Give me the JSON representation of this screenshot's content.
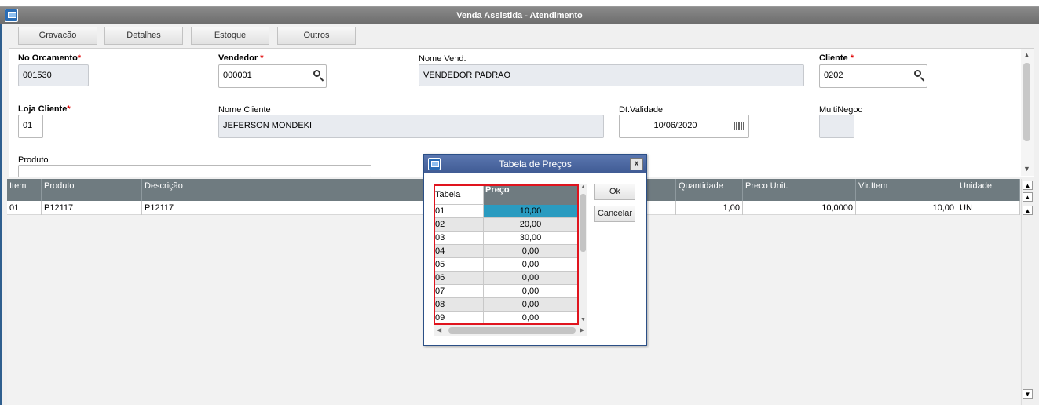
{
  "window": {
    "title": "Venda Assistida - Atendimento"
  },
  "toolbar": {
    "gravacao": "Gravacão",
    "detalhes": "Detalhes",
    "estoque": "Estoque",
    "outros": "Outros"
  },
  "form": {
    "required_mark": "*",
    "no_orcamento": {
      "label": "No Orcamento",
      "value": "001530"
    },
    "vendedor": {
      "label": "Vendedor",
      "value": "000001"
    },
    "nome_vend": {
      "label": "Nome Vend.",
      "value": "VENDEDOR PADRAO"
    },
    "cliente": {
      "label": "Cliente",
      "value": "0202"
    },
    "loja_cliente": {
      "label": "Loja Cliente",
      "value": "01"
    },
    "nome_cliente": {
      "label": "Nome Cliente",
      "value": "JEFERSON MONDEKI"
    },
    "dt_validade": {
      "label": "Dt.Validade",
      "value": "10/06/2020"
    },
    "multinegoc": {
      "label": "MultiNegoc",
      "value": ""
    },
    "produto": {
      "label": "Produto",
      "value": ""
    }
  },
  "grid": {
    "columns": [
      "Item",
      "Produto",
      "Descrição",
      "Quantidade",
      "Preco Unit.",
      "Vlr.Item",
      "Unidade"
    ],
    "rows": [
      {
        "item": "01",
        "produto": "P12117",
        "descricao": "P12117",
        "quantidade": "1,00",
        "preco_unit": "10,0000",
        "vlr_item": "10,00",
        "unidade": "UN"
      }
    ]
  },
  "dialog": {
    "title": "Tabela de Preços",
    "close": "x",
    "col_tabela": "Tabela",
    "col_preco": "Preço",
    "rows": [
      {
        "tabela": "01",
        "preco": "10,00"
      },
      {
        "tabela": "02",
        "preco": "20,00"
      },
      {
        "tabela": "03",
        "preco": "30,00"
      },
      {
        "tabela": "04",
        "preco": "0,00"
      },
      {
        "tabela": "05",
        "preco": "0,00"
      },
      {
        "tabela": "06",
        "preco": "0,00"
      },
      {
        "tabela": "07",
        "preco": "0,00"
      },
      {
        "tabela": "08",
        "preco": "0,00"
      },
      {
        "tabela": "09",
        "preco": "0,00"
      }
    ],
    "ok": "Ok",
    "cancel": "Cancelar"
  },
  "colors": {
    "title_bar": "#6c6c6c",
    "grid_header": "#6f7b80",
    "dialog_title": "#3f5a93",
    "selection": "#2a9bc0",
    "highlight_border": "#e0141e",
    "required": "#e00000"
  },
  "icons": {
    "window": "window-icon",
    "lookup": "search-icon",
    "date": "calendar-icon"
  }
}
